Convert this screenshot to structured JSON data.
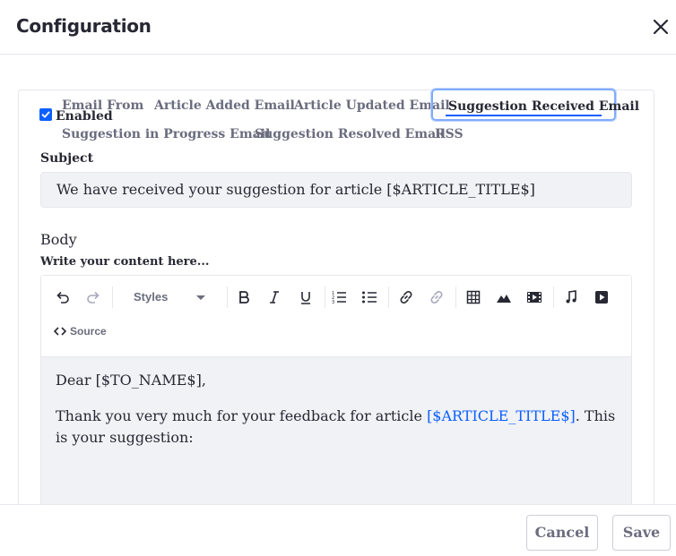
{
  "dialog": {
    "title": "Configuration"
  },
  "tabs": [
    {
      "label": "Email From",
      "active": false
    },
    {
      "label": "Article Added Email",
      "active": false
    },
    {
      "label": "Article Updated Email",
      "active": false
    },
    {
      "label": "Suggestion Received Email",
      "active": true
    },
    {
      "label": "Suggestion in Progress Email",
      "active": false
    },
    {
      "label": "Suggestion Resolved Email",
      "active": false
    },
    {
      "label": "RSS",
      "active": false
    }
  ],
  "enabled": {
    "label": "Enabled",
    "checked": true
  },
  "subject": {
    "label": "Subject",
    "value": "We have received your suggestion for article [$ARTICLE_TITLE$]"
  },
  "body": {
    "label": "Body",
    "helper": "Write your content here...",
    "toolbar": {
      "styles_label": "Styles",
      "source_label": "Source",
      "icons": [
        "undo-icon",
        "redo-icon",
        "bold-icon",
        "italic-icon",
        "underline-icon",
        "numbered-list-icon",
        "bulleted-list-icon",
        "link-icon",
        "unlink-icon",
        "table-icon",
        "image-icon",
        "video-icon",
        "audio-icon",
        "youtube-icon",
        "source-code-icon"
      ]
    },
    "content": {
      "greeting": "Dear [$TO_NAME$],",
      "line_prefix": "Thank you very much for your feedback for article ",
      "line_link": "[$ARTICLE_TITLE$]",
      "line_suffix": ". This is your suggestion:"
    }
  },
  "footer": {
    "cancel_label": "Cancel",
    "save_label": "Save"
  },
  "colors": {
    "accent": "#0b5fff",
    "text": "#272833",
    "muted": "#6b6c7e",
    "field_bg": "#f1f2f5",
    "border": "#e7e7ed"
  }
}
